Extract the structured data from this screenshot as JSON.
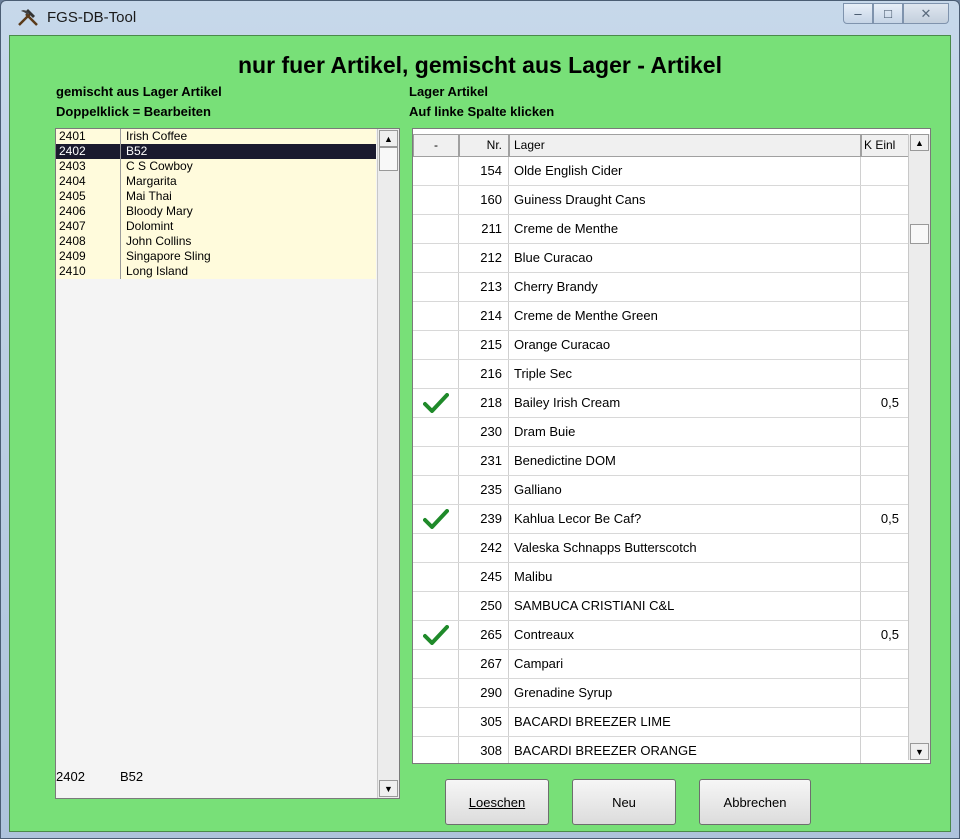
{
  "window": {
    "title": "FGS-DB-Tool",
    "minimize_glyph": "–",
    "maximize_glyph": "□",
    "close_glyph": "✕"
  },
  "heading": "nur fuer Artikel, gemischt aus Lager - Artikel",
  "left": {
    "label1": "gemischt aus Lager Artikel",
    "label2": "Doppelklick = Bearbeiten",
    "items": [
      {
        "code": "2401",
        "name": "Irish Coffee"
      },
      {
        "code": "2402",
        "name": "B52"
      },
      {
        "code": "2403",
        "name": "C S Cowboy"
      },
      {
        "code": "2404",
        "name": "Margarita"
      },
      {
        "code": "2405",
        "name": "Mai Thai"
      },
      {
        "code": "2406",
        "name": "Bloody Mary"
      },
      {
        "code": "2407",
        "name": "Dolomint"
      },
      {
        "code": "2408",
        "name": "John Collins"
      },
      {
        "code": "2409",
        "name": "Singapore Sling"
      },
      {
        "code": "2410",
        "name": "Long Island"
      }
    ],
    "selected_index": 1,
    "selected_code": "2402",
    "selected_name": "B52"
  },
  "right": {
    "label1": "Lager Artikel",
    "label2": "Auf linke Spalte klicken",
    "columns": [
      "-",
      "Nr.",
      "Lager",
      "K Einl"
    ],
    "rows": [
      {
        "checked": false,
        "nr": "154",
        "name": "Olde English Cider",
        "k": ""
      },
      {
        "checked": false,
        "nr": "160",
        "name": "Guiness Draught Cans",
        "k": ""
      },
      {
        "checked": false,
        "nr": "211",
        "name": "Creme de Menthe",
        "k": ""
      },
      {
        "checked": false,
        "nr": "212",
        "name": "Blue Curacao",
        "k": ""
      },
      {
        "checked": false,
        "nr": "213",
        "name": "Cherry Brandy",
        "k": ""
      },
      {
        "checked": false,
        "nr": "214",
        "name": "Creme de Menthe Green",
        "k": ""
      },
      {
        "checked": false,
        "nr": "215",
        "name": "Orange Curacao",
        "k": ""
      },
      {
        "checked": false,
        "nr": "216",
        "name": "Triple Sec",
        "k": ""
      },
      {
        "checked": true,
        "nr": "218",
        "name": "Bailey Irish Cream",
        "k": "0,5"
      },
      {
        "checked": false,
        "nr": "230",
        "name": "Dram Buie",
        "k": ""
      },
      {
        "checked": false,
        "nr": "231",
        "name": "Benedictine DOM",
        "k": ""
      },
      {
        "checked": false,
        "nr": "235",
        "name": "Galliano",
        "k": ""
      },
      {
        "checked": true,
        "nr": "239",
        "name": "Kahlua Lecor Be Caf?",
        "k": "0,5"
      },
      {
        "checked": false,
        "nr": "242",
        "name": "Valeska Schnapps Butterscotch",
        "k": ""
      },
      {
        "checked": false,
        "nr": "245",
        "name": "Malibu",
        "k": ""
      },
      {
        "checked": false,
        "nr": "250",
        "name": "SAMBUCA CRISTIANI C&L",
        "k": ""
      },
      {
        "checked": true,
        "nr": "265",
        "name": "Contreaux",
        "k": "0,5"
      },
      {
        "checked": false,
        "nr": "267",
        "name": "Campari",
        "k": ""
      },
      {
        "checked": false,
        "nr": "290",
        "name": "Grenadine Syrup",
        "k": ""
      },
      {
        "checked": false,
        "nr": "305",
        "name": "BACARDI BREEZER LIME",
        "k": ""
      },
      {
        "checked": false,
        "nr": "308",
        "name": "BACARDI BREEZER ORANGE",
        "k": ""
      }
    ]
  },
  "buttons": {
    "delete": "Loeschen",
    "new": "Neu",
    "cancel": "Abbrechen"
  },
  "icons": {
    "app": "hammer-pick-icon",
    "check": "check-icon",
    "scroll_up": "arrow-up-icon",
    "scroll_down": "arrow-down-icon"
  },
  "colors": {
    "background": "#78e078",
    "selection": "#1a1a2e",
    "list_row": "#fffbdc",
    "checkmark": "#1f8a2a"
  }
}
